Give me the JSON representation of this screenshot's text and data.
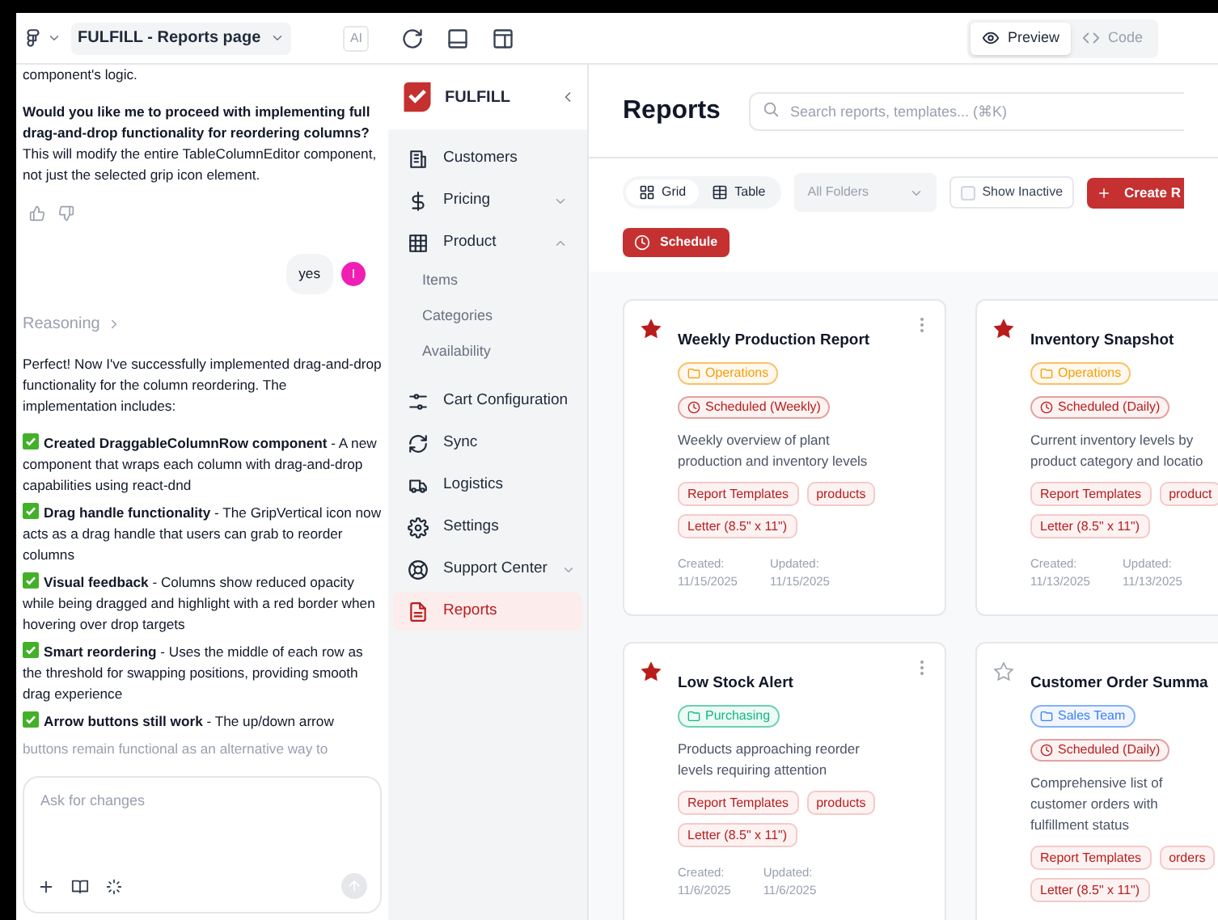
{
  "project": {
    "title": "FULFILL - Reports page",
    "badge": "AI"
  },
  "view_tabs": [
    {
      "label": "Preview",
      "selected": true
    },
    {
      "label": "Code",
      "selected": false
    }
  ],
  "chat": {
    "messages": [
      {
        "kind": "text",
        "text": "component's logic."
      },
      {
        "kind": "text",
        "text": "**Would you like me to proceed with implementing full drag-and-drop functionality for reordering columns?** This will modify the entire TableColumnEditor component, not just the selected grip icon element."
      },
      {
        "kind": "feedback"
      },
      {
        "kind": "user",
        "text": "yes",
        "avatar": "I"
      },
      {
        "kind": "reasoning",
        "text": "Reasoning"
      },
      {
        "kind": "text",
        "text": "Perfect! Now I've successfully implemented drag-and-drop functionality for the column reordering. The implementation includes:"
      },
      {
        "kind": "check",
        "text": "**Created DraggableColumnRow component** - A new component that wraps each column with drag-and-drop capabilities using react-dnd"
      },
      {
        "kind": "check",
        "text": "**Drag handle functionality** - The GripVertical icon now acts as a drag handle that users can grab to reorder columns"
      },
      {
        "kind": "check",
        "text": "**Visual feedback** - Columns show reduced opacity while being dragged and highlight with a red border when hovering over drop targets"
      },
      {
        "kind": "check",
        "text": "**Smart reordering** - Uses the middle of each row as the threshold for swapping positions, providing smooth drag experience"
      },
      {
        "kind": "check",
        "text": "**Arrow buttons still work** - The up/down arrow"
      },
      {
        "kind": "fade",
        "text": "buttons remain functional as an alternative way to"
      }
    ],
    "input": {
      "placeholder": "Ask for changes"
    }
  },
  "sidebar": {
    "brand": "FULFILL",
    "items": [
      {
        "label": "Customers",
        "selected": false
      },
      {
        "label": "Pricing",
        "selected": false,
        "expanded": false
      },
      {
        "label": "Product",
        "selected": false,
        "expanded": true,
        "children": [
          {
            "label": "Items"
          },
          {
            "label": "Categories"
          },
          {
            "label": "Availability"
          }
        ]
      },
      {
        "label": "Cart Configuration",
        "selected": false
      },
      {
        "label": "Sync",
        "selected": false
      },
      {
        "label": "Logistics",
        "selected": false
      },
      {
        "label": "Settings",
        "selected": false
      },
      {
        "label": "Support Center",
        "selected": false,
        "expanded": false
      },
      {
        "label": "Reports",
        "selected": true
      }
    ]
  },
  "page": {
    "title": "Reports",
    "search": {
      "placeholder": "Search reports, templates... (⌘K)"
    },
    "layout_toggle": [
      {
        "label": "Grid",
        "selected": true
      },
      {
        "label": "Table",
        "selected": false
      }
    ],
    "folder_select": {
      "placeholder": "All Folders"
    },
    "show_inactive": {
      "label": "Show Inactive",
      "checked": false
    },
    "create_button": "Create R",
    "schedule_button": "Schedule"
  },
  "cards": [
    {
      "title": "Weekly Production Report",
      "starred": true,
      "folder": {
        "label": "Operations",
        "color": "#f59e0b"
      },
      "schedule": "Scheduled (Weekly)",
      "description": "Weekly overview of plant production and inventory levels",
      "tags": [
        "Report Templates",
        "products",
        "Letter (8.5\" x 11\")"
      ],
      "created_label": "Created:",
      "created": "11/15/2025",
      "updated_label": "Updated:",
      "updated": "11/15/2025"
    },
    {
      "title": "Inventory Snapshot",
      "starred": true,
      "folder": {
        "label": "Operations",
        "color": "#f59e0b"
      },
      "schedule": "Scheduled (Daily)",
      "description": "Current inventory levels by product category and locatio",
      "tags": [
        "Report Templates",
        "product",
        "Letter (8.5\" x 11\")"
      ],
      "created_label": "Created:",
      "created": "11/13/2025",
      "updated_label": "Updated:",
      "updated": "11/13/2025"
    },
    {
      "title": "Low Stock Alert",
      "starred": true,
      "folder": {
        "label": "Purchasing",
        "color": "#10b981"
      },
      "description": "Products approaching reorder levels requiring attention",
      "tags": [
        "Report Templates",
        "products",
        "Letter (8.5\" x 11\")"
      ],
      "created_label": "Created:",
      "created": "11/6/2025",
      "updated_label": "Updated:",
      "updated": "11/6/2025"
    },
    {
      "title": "Customer Order Summa",
      "starred": false,
      "folder": {
        "label": "Sales Team",
        "color": "#3b82f6"
      },
      "schedule": "Scheduled (Daily)",
      "description": "Comprehensive list of customer orders with fulfillment status",
      "tags": [
        "Report Templates",
        "orders",
        "Letter (8.5\" x 11\")"
      ]
    }
  ]
}
